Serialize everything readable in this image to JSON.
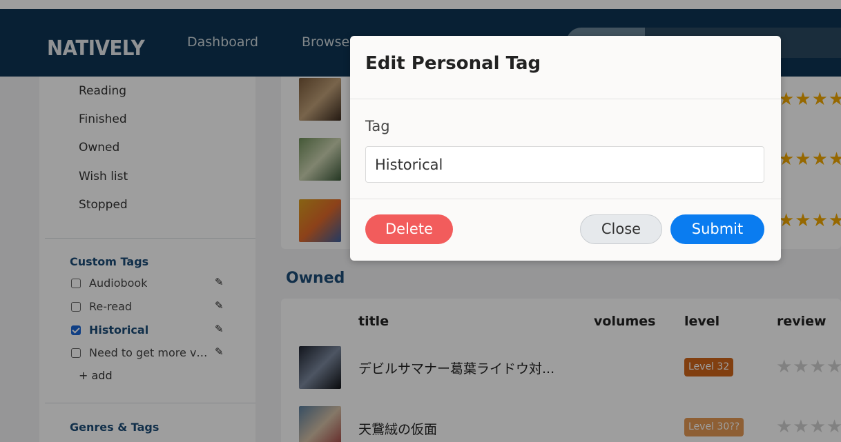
{
  "navbar": {
    "logo": "NATIVELY",
    "links": [
      "Dashboard",
      "Browse"
    ]
  },
  "sidebar": {
    "statuses": [
      "Reading",
      "Finished",
      "Owned",
      "Wish list",
      "Stopped"
    ],
    "custom_tags_title": "Custom Tags",
    "custom_tags": [
      {
        "label": "Audiobook",
        "checked": false
      },
      {
        "label": "Re-read",
        "checked": false
      },
      {
        "label": "Historical",
        "checked": true
      },
      {
        "label": "Need to get more volumes",
        "checked": false
      }
    ],
    "add_label": "+ add",
    "genres_title": "Genres & Tags"
  },
  "main": {
    "owned_heading": "Owned",
    "columns": {
      "title": "title",
      "volumes": "volumes",
      "level": "level",
      "review": "review"
    },
    "rows": [
      {
        "title": "デビルサマナー葛葉ライドウ対...",
        "level": "Level 32"
      },
      {
        "title": "天鵞絨の仮面",
        "level": "Level 30??"
      }
    ],
    "stars": "★★★★"
  },
  "modal": {
    "title": "Edit Personal Tag",
    "field_label": "Tag",
    "field_value": "Historical",
    "delete_label": "Delete",
    "close_label": "Close",
    "submit_label": "Submit"
  },
  "colors": {
    "navbar": "#0d3554",
    "accent_blue": "#0a7cf0",
    "delete_red": "#f25c5c",
    "level_orange": "#d0661a",
    "star_gold": "#f2a900"
  }
}
